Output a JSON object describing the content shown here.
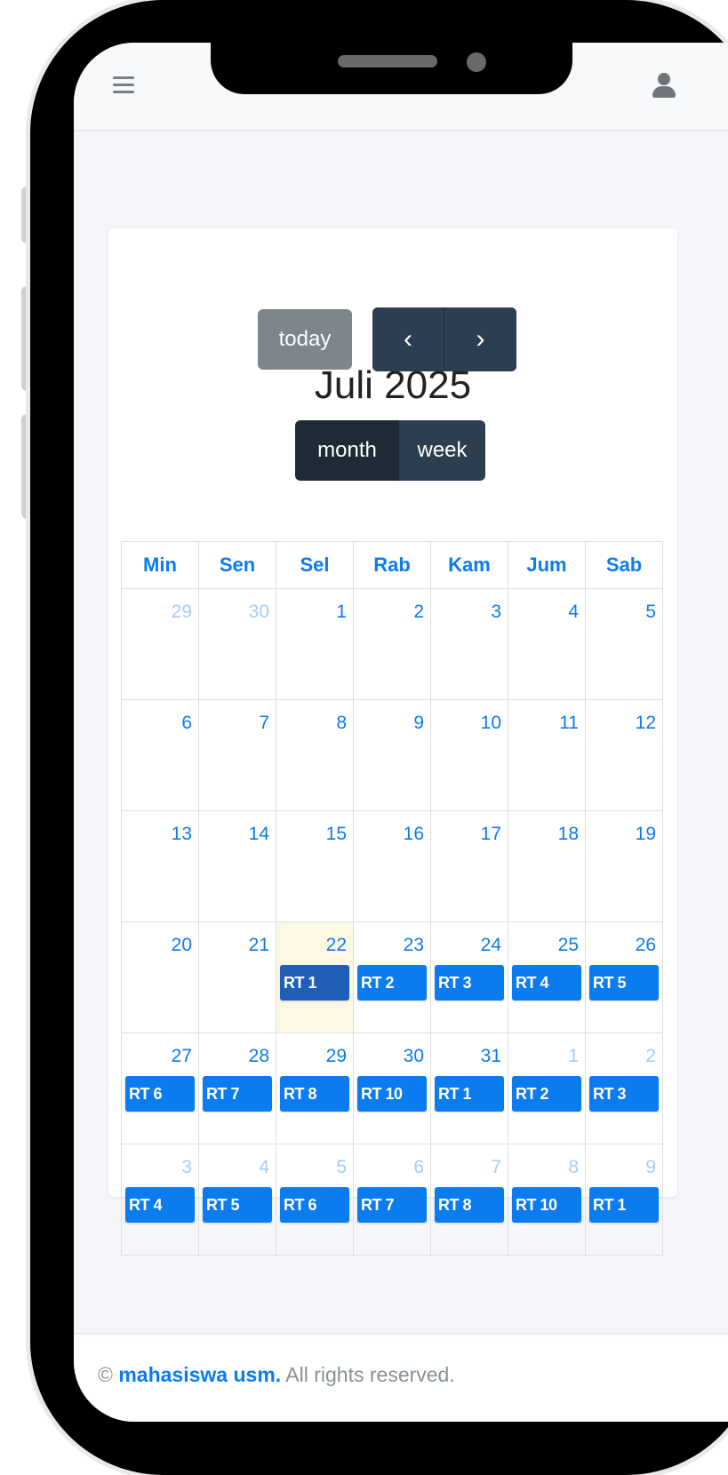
{
  "header": {
    "menu_icon": "hamburger-icon",
    "user_icon": "user-icon"
  },
  "toolbar": {
    "today_label": "today",
    "prev_label": "‹",
    "next_label": "›",
    "month_label": "month",
    "week_label": "week"
  },
  "calendar": {
    "title": "Juli 2025",
    "weekdays": [
      "Min",
      "Sen",
      "Sel",
      "Rab",
      "Kam",
      "Jum",
      "Sab"
    ],
    "weeks": [
      [
        {
          "day": "29",
          "other": true,
          "events": []
        },
        {
          "day": "30",
          "other": true,
          "events": []
        },
        {
          "day": "1",
          "events": []
        },
        {
          "day": "2",
          "events": []
        },
        {
          "day": "3",
          "events": []
        },
        {
          "day": "4",
          "events": []
        },
        {
          "day": "5",
          "events": []
        }
      ],
      [
        {
          "day": "6",
          "events": []
        },
        {
          "day": "7",
          "events": []
        },
        {
          "day": "8",
          "events": []
        },
        {
          "day": "9",
          "events": []
        },
        {
          "day": "10",
          "events": []
        },
        {
          "day": "11",
          "events": []
        },
        {
          "day": "12",
          "events": []
        }
      ],
      [
        {
          "day": "13",
          "events": []
        },
        {
          "day": "14",
          "events": []
        },
        {
          "day": "15",
          "events": []
        },
        {
          "day": "16",
          "events": []
        },
        {
          "day": "17",
          "events": []
        },
        {
          "day": "18",
          "events": []
        },
        {
          "day": "19",
          "events": []
        }
      ],
      [
        {
          "day": "20",
          "events": []
        },
        {
          "day": "21",
          "events": []
        },
        {
          "day": "22",
          "today": true,
          "events": [
            "RT 1"
          ],
          "active": true
        },
        {
          "day": "23",
          "events": [
            "RT 2"
          ]
        },
        {
          "day": "24",
          "events": [
            "RT 3"
          ]
        },
        {
          "day": "25",
          "events": [
            "RT 4"
          ]
        },
        {
          "day": "26",
          "events": [
            "RT 5"
          ]
        }
      ],
      [
        {
          "day": "27",
          "events": [
            "RT 6"
          ]
        },
        {
          "day": "28",
          "events": [
            "RT 7"
          ]
        },
        {
          "day": "29",
          "events": [
            "RT 8"
          ]
        },
        {
          "day": "30",
          "events": [
            "RT 10"
          ]
        },
        {
          "day": "31",
          "events": [
            "RT 1"
          ]
        },
        {
          "day": "1",
          "other": true,
          "events": [
            "RT 2"
          ]
        },
        {
          "day": "2",
          "other": true,
          "events": [
            "RT 3"
          ]
        }
      ],
      [
        {
          "day": "3",
          "other": true,
          "events": [
            "RT 4"
          ]
        },
        {
          "day": "4",
          "other": true,
          "events": [
            "RT 5"
          ]
        },
        {
          "day": "5",
          "other": true,
          "events": [
            "RT 6"
          ]
        },
        {
          "day": "6",
          "other": true,
          "events": [
            "RT 7"
          ]
        },
        {
          "day": "7",
          "other": true,
          "events": [
            "RT 8"
          ]
        },
        {
          "day": "8",
          "other": true,
          "events": [
            "RT 10"
          ]
        },
        {
          "day": "9",
          "other": true,
          "events": [
            "RT 1"
          ]
        }
      ]
    ]
  },
  "footer": {
    "copyright": "©",
    "brand": "mahasiswa usm.",
    "rights": "All rights reserved."
  },
  "colors": {
    "accent": "#0b7bf0",
    "dark": "#2c3e50",
    "today_bg": "#fcf8e3"
  }
}
